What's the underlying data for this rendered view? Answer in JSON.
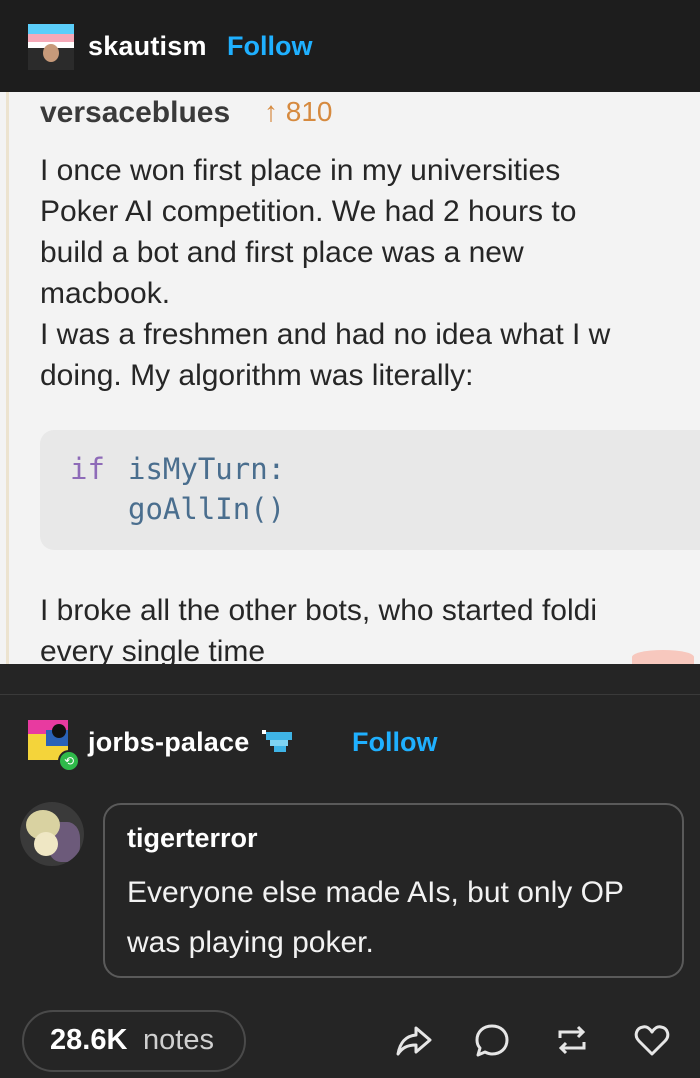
{
  "op_post": {
    "username": "skautism",
    "follow_label": "Follow"
  },
  "screenshot": {
    "original_author": "versaceblues",
    "upvotes": "810",
    "body_lines": [
      "I once won first place in my universities",
      "Poker AI competition. We had 2 hours to",
      "build a bot and first place was a new",
      "macbook.",
      "I was a freshmen and had no idea what I w",
      "doing. My algorithm was literally:"
    ],
    "code": {
      "kw_if": "if",
      "condition": "isMyTurn:",
      "call": "goAllIn()"
    },
    "tail_lines": [
      "I broke all the other bots, who started foldi",
      "every single time"
    ]
  },
  "reblog": {
    "username": "jorbs-palace",
    "follow_label": "Follow"
  },
  "comment": {
    "author": "tigerterror",
    "lines": [
      "Everyone else made AIs, but only OP",
      "was playing poker."
    ]
  },
  "footer": {
    "notes_count": "28.6K",
    "notes_label": "notes",
    "actions": [
      "share-icon",
      "reply-icon",
      "reblog-icon",
      "like-icon"
    ]
  },
  "colors": {
    "accent": "#1fb0ff",
    "background": "#252525",
    "header": "#1d1d1d",
    "upvote": "#d68a3f"
  }
}
